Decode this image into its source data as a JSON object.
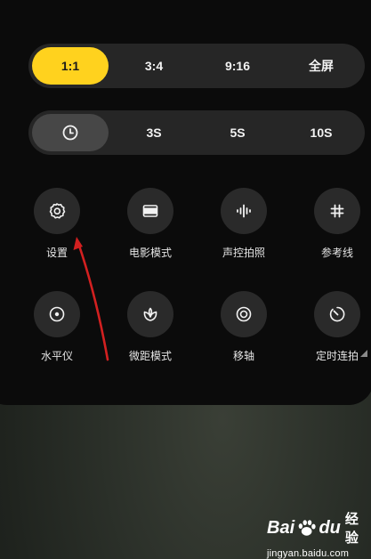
{
  "aspect_ratio": {
    "options": [
      "1:1",
      "3:4",
      "9:16",
      "全屏"
    ],
    "selected": "1:1",
    "selected_color": "#ffd21e"
  },
  "timer": {
    "icon": "clock-icon",
    "options": [
      "3S",
      "5S",
      "10S"
    ],
    "selected": "clock-icon"
  },
  "tiles": [
    {
      "label": "设置",
      "icon": "gear-icon"
    },
    {
      "label": "电影模式",
      "icon": "movie-frame-icon"
    },
    {
      "label": "声控拍照",
      "icon": "voice-wave-icon"
    },
    {
      "label": "参考线",
      "icon": "grid-hash-icon"
    },
    {
      "label": "水平仪",
      "icon": "level-icon"
    },
    {
      "label": "微距模式",
      "icon": "macro-flower-icon"
    },
    {
      "label": "移轴",
      "icon": "tilt-shift-icon"
    },
    {
      "label": "定时连拍",
      "icon": "timer-burst-icon"
    }
  ],
  "annotation": {
    "type": "red-arrow",
    "color": "#d32020",
    "points_to": "设置"
  },
  "watermark": {
    "brand_bai": "Bai",
    "brand_du": "du",
    "brand_cn": "经验",
    "url": "jingyan.baidu.com"
  }
}
